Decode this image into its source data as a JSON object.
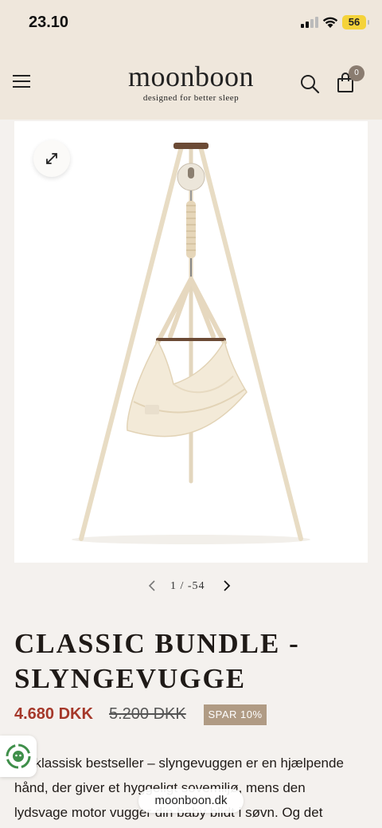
{
  "status_bar": {
    "time": "23.10",
    "battery": "56"
  },
  "header": {
    "logo_name": "moonboon",
    "logo_tagline": "designed for better sleep",
    "cart_count": "0"
  },
  "gallery": {
    "current": "1",
    "separator": "/",
    "total": "-54"
  },
  "product": {
    "title_line1": "CLASSIC BUNDLE -",
    "title_line2": "SLYNGEVUGGE",
    "price": "4.680 DKK",
    "old_price": "5.200 DKK",
    "discount": "SPAR 10%",
    "description_lines": [
      "En klassisk bestseller – slyngevuggen er en hjælpende",
      "hånd, der giver et hyggeligt sovemiljø, mens den",
      "lydsvage motor vugger din baby blidt i søvn. Og det"
    ]
  },
  "browser": {
    "url": "moonboon.dk"
  },
  "colors": {
    "header_bg": "#efe7dc",
    "page_bg": "#f4f1ee",
    "price_red": "#a5382a",
    "badge_tan": "#b09b84"
  },
  "icons": {
    "menu": "hamburger-menu-icon",
    "search": "search-icon",
    "cart": "shopping-bag-icon",
    "expand": "expand-icon",
    "prev": "chevron-left-icon",
    "next": "chevron-right-icon",
    "chat": "chat-widget-icon"
  }
}
